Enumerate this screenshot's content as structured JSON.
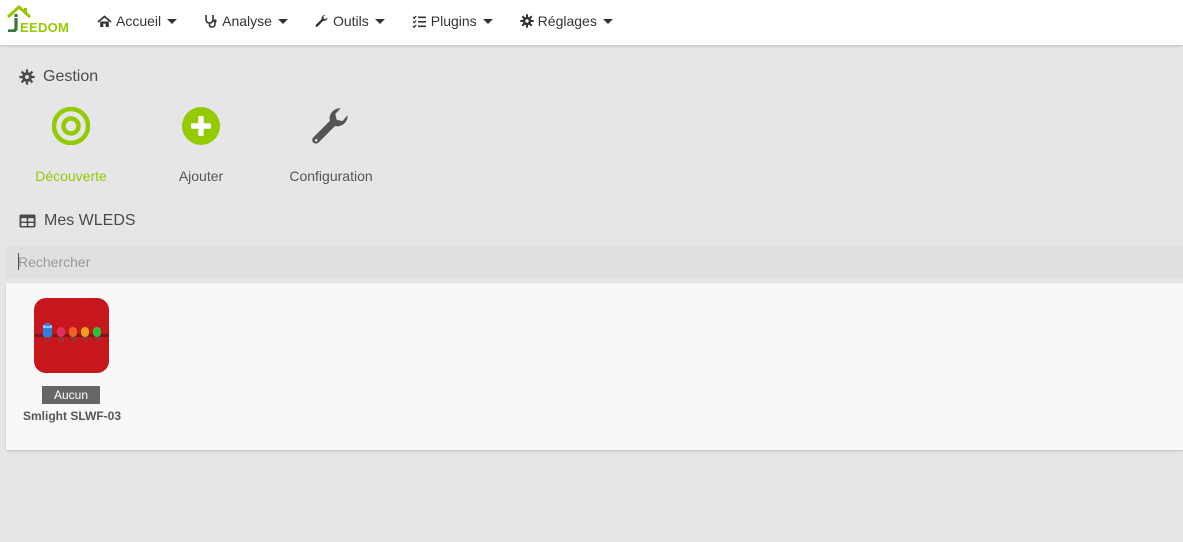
{
  "brand": {
    "first_letter": "J",
    "rest": "EEDOM"
  },
  "nav": {
    "items": [
      {
        "label": "Accueil",
        "icon": "home-icon"
      },
      {
        "label": "Analyse",
        "icon": "stethoscope-icon"
      },
      {
        "label": "Outils",
        "icon": "wrench-icon"
      },
      {
        "label": "Plugins",
        "icon": "list-icon"
      },
      {
        "label": "Réglages",
        "icon": "gear-icon"
      }
    ]
  },
  "gestion": {
    "title": "Gestion",
    "cards": [
      {
        "label": "Découverte",
        "icon": "target-icon",
        "active": true
      },
      {
        "label": "Ajouter",
        "icon": "plus-circle-icon",
        "active": false
      },
      {
        "label": "Configuration",
        "icon": "wrench-icon",
        "active": false
      }
    ]
  },
  "equipments": {
    "title": "Mes WLEDS",
    "search_placeholder": "Rechercher",
    "items": [
      {
        "badge": "Aucun",
        "name": "Smlight SLWF-03",
        "icon": "wled-led-strip-icon"
      }
    ]
  },
  "colors": {
    "accent": "#94ca02",
    "brand_dark": "#3c763d",
    "tile_red": "#c8161d"
  }
}
